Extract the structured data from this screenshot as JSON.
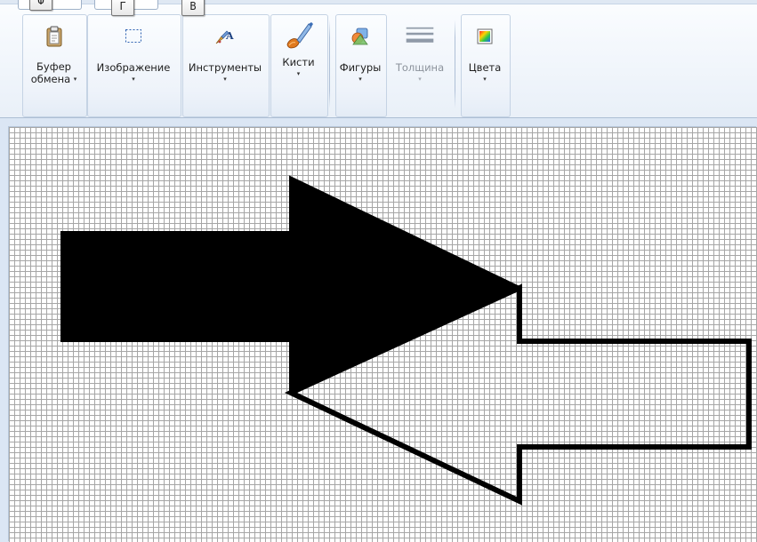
{
  "ribbon": {
    "keytips": [
      "Ф",
      "Г",
      "В"
    ],
    "groups": {
      "clipboard": {
        "line1": "Буфер",
        "line2": "обмена",
        "icon": "clipboard-icon"
      },
      "image": {
        "label": "Изображение",
        "icon": "select-icon"
      },
      "tools": {
        "label": "Инструменты",
        "icon": "tools-icon"
      },
      "brushes": {
        "label": "Кисти",
        "icon": "brush-icon"
      },
      "shapes": {
        "label": "Фигуры",
        "icon": "shapes-icon"
      },
      "size": {
        "label": "Толщина",
        "icon": "line-thickness-icon",
        "enabled": false
      },
      "colors": {
        "label": "Цвета",
        "icon": "color-palette-icon"
      }
    },
    "dropdown_glyph": "▾"
  },
  "canvas": {
    "grid": "on",
    "colors": {
      "fill": "#000000",
      "outline": "#000000",
      "gridline": "#a6a6a6"
    }
  }
}
